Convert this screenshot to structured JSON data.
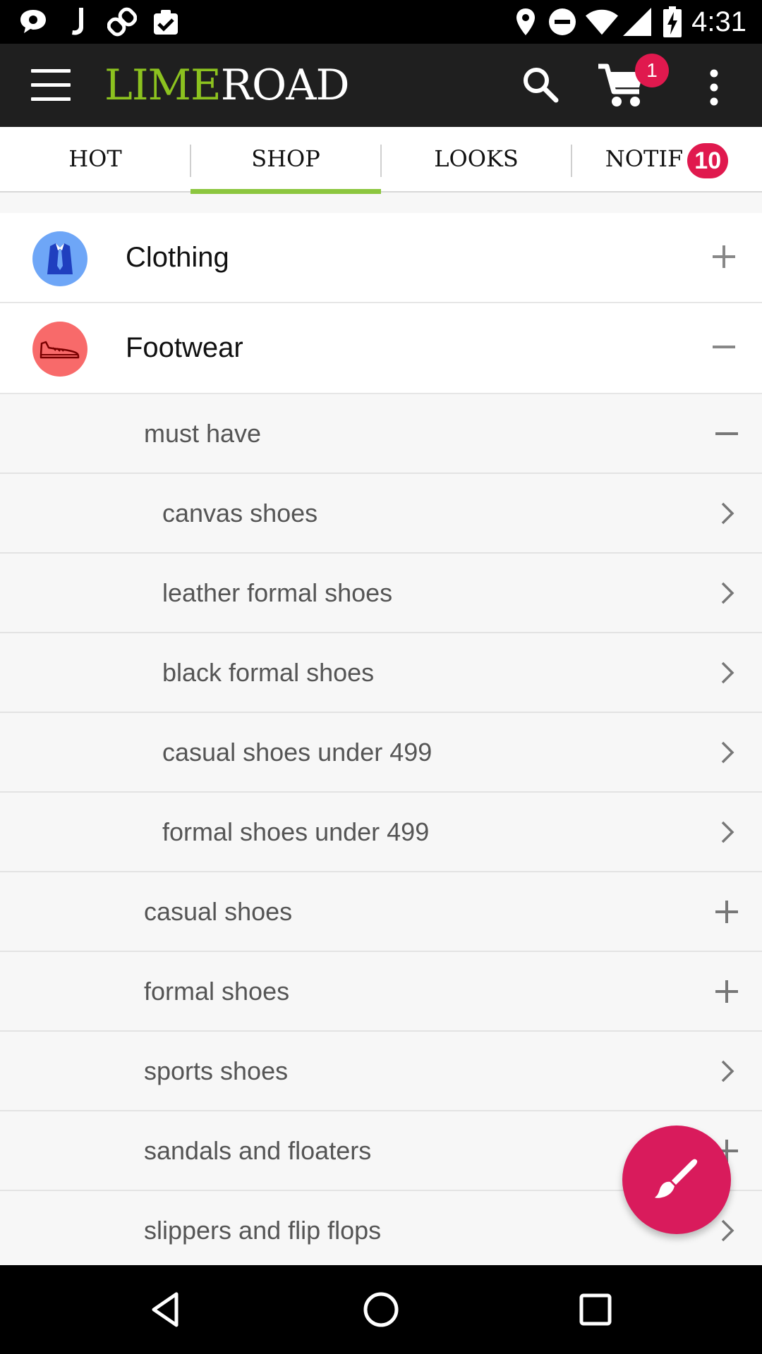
{
  "status_bar": {
    "time": "4:31",
    "left_icons": [
      "chat-icon",
      "music-note-icon",
      "link-icon",
      "clipboard-check-icon"
    ],
    "right_icons": [
      "location-pin-icon",
      "do-not-disturb-icon",
      "wifi-icon",
      "cell-signal-icon",
      "battery-charging-icon"
    ]
  },
  "app_bar": {
    "logo_part1": "LIME",
    "logo_part2": "ROAD",
    "cart_count": "1"
  },
  "tabs": [
    {
      "label": "HOT",
      "active": false
    },
    {
      "label": "SHOP",
      "active": true
    },
    {
      "label": "LOOKS",
      "active": false
    },
    {
      "label": "NOTIF",
      "active": false,
      "badge": "10"
    }
  ],
  "categories": [
    {
      "label": "Clothing",
      "icon": "shirt-tie-icon",
      "icon_color": "#6ea6f7",
      "state": "collapsed"
    },
    {
      "label": "Footwear",
      "icon": "shoe-icon",
      "icon_color": "#f86a6a",
      "state": "expanded"
    }
  ],
  "footwear_items": [
    {
      "label": "must have",
      "level": 1,
      "action": "collapse"
    },
    {
      "label": "canvas shoes",
      "level": 2,
      "action": "navigate"
    },
    {
      "label": "leather formal shoes",
      "level": 2,
      "action": "navigate"
    },
    {
      "label": "black formal shoes",
      "level": 2,
      "action": "navigate"
    },
    {
      "label": "casual shoes under 499",
      "level": 2,
      "action": "navigate"
    },
    {
      "label": "formal shoes under 499",
      "level": 2,
      "action": "navigate"
    },
    {
      "label": "casual shoes",
      "level": 1,
      "action": "expand"
    },
    {
      "label": "formal shoes",
      "level": 1,
      "action": "expand"
    },
    {
      "label": "sports shoes",
      "level": 1,
      "action": "navigate"
    },
    {
      "label": "sandals and floaters",
      "level": 1,
      "action": "expand"
    },
    {
      "label": "slippers and flip flops",
      "level": 1,
      "action": "navigate"
    }
  ],
  "fab": {
    "icon": "paintbrush-icon",
    "color": "#d91b5c"
  },
  "colors": {
    "accent_green": "#8cc63f",
    "badge_red": "#e0194e",
    "app_bar": "#1f1f1f"
  },
  "nav_bar": {
    "icons": [
      "back-icon",
      "home-icon",
      "recents-icon"
    ]
  }
}
